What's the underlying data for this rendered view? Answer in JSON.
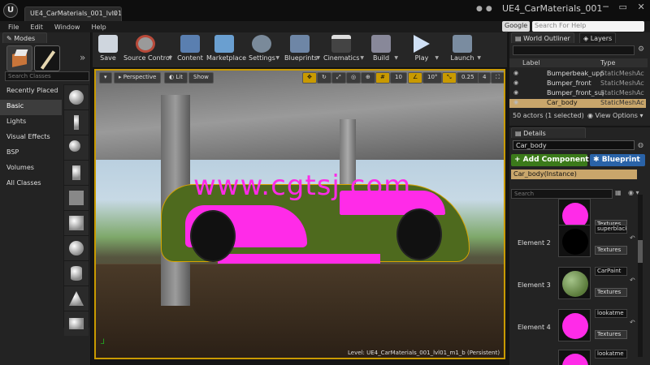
{
  "window": {
    "doc_tab": "UE4_CarMaterials_001_lvl01",
    "title": "UE4_CarMaterials_001",
    "controls": [
      "─",
      "▭",
      "✕"
    ],
    "logo_text": "U"
  },
  "menu": [
    "File",
    "Edit",
    "Window",
    "Help"
  ],
  "help": {
    "engine": "Google",
    "placeholder": "Search For Help"
  },
  "modes": {
    "tab": "Modes",
    "search_placeholder": "Search Classes",
    "categories": [
      "Recently Placed",
      "Basic",
      "Lights",
      "Visual Effects",
      "BSP",
      "Volumes",
      "All Classes"
    ],
    "selected": "Basic"
  },
  "toolbar": {
    "items": [
      {
        "label": "Save",
        "color": "#cfd6de"
      },
      {
        "label": "Source Control",
        "color": "#b84a3a"
      },
      {
        "label": "Content",
        "color": "#5a7fb0"
      },
      {
        "label": "Marketplace",
        "color": "#6a9fd0"
      },
      {
        "label": "Settings",
        "color": "#7a8a9a"
      },
      {
        "label": "Blueprints",
        "color": "#6e86a6"
      },
      {
        "label": "Cinematics",
        "color": "#555"
      },
      {
        "label": "Build",
        "color": "#889"
      },
      {
        "label": "Play",
        "color": "#4a7bd0"
      },
      {
        "label": "Launch",
        "color": "#7a8ca0"
      }
    ]
  },
  "viewport": {
    "perspective": "Perspective",
    "lit": "Lit",
    "show": "Show",
    "grid": "10",
    "angle": "10°",
    "scale": "0.25",
    "cam_speed": "4",
    "level_label": "Level:",
    "level_name": "UE4_CarMaterials_001_lvl01_m1_b (Persistent)",
    "watermark": "www.cgtsj.com"
  },
  "outliner": {
    "tab_outliner": "World Outliner",
    "tab_layers": "Layers",
    "col_label": "Label",
    "col_type": "Type",
    "rows": [
      {
        "name": "Bumperbeak_upper",
        "type": "StaticMeshActor"
      },
      {
        "name": "Bumper_front",
        "type": "StaticMeshActor"
      },
      {
        "name": "Bumper_front_support",
        "type": "StaticMeshActor"
      },
      {
        "name": "Car_body",
        "type": "StaticMeshActor",
        "selected": true
      }
    ],
    "footer": "50 actors (1 selected)",
    "view_options": "View Options"
  },
  "details": {
    "tab": "Details",
    "name": "Car_body",
    "add_component": "+ Add Component",
    "blueprint": "Blueprint",
    "instance": "Car_body(Instance)",
    "search_placeholder": "Search",
    "elements": [
      {
        "label": "",
        "material": "",
        "tex": "Textures",
        "color": "#ff2be8"
      },
      {
        "label": "Element 2",
        "material": "superblack",
        "tex": "Textures",
        "color": "#000000"
      },
      {
        "label": "Element 3",
        "material": "CarPaint",
        "tex": "Textures",
        "color": "#5a7a3a"
      },
      {
        "label": "Element 4",
        "material": "lookatme",
        "tex": "Textures",
        "color": "#ff2be8"
      },
      {
        "label": "",
        "material": "lookatme",
        "tex": "",
        "color": "#ff2be8"
      }
    ]
  },
  "colors": {
    "accent": "#c99a00",
    "selection": "#c9a66b",
    "magenta": "#ff2be8",
    "add_green": "#3b7a1a",
    "bp_blue": "#2a63a8"
  }
}
